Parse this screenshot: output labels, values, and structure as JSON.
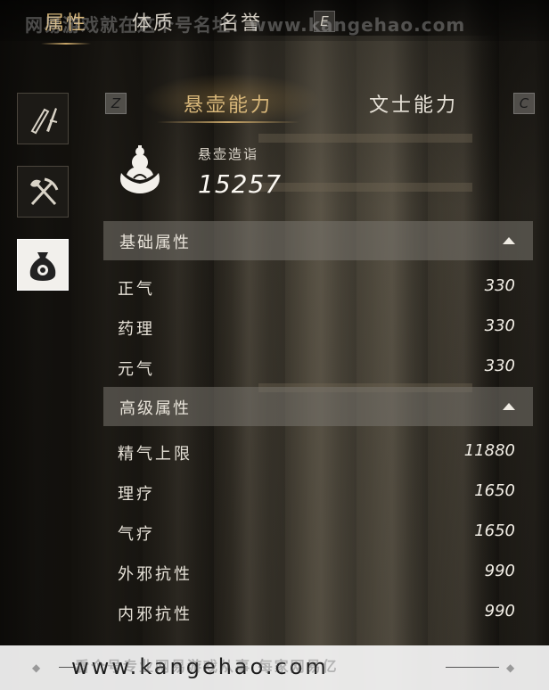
{
  "top_tabs": [
    {
      "label": "属性",
      "active": true
    },
    {
      "label": "体质",
      "active": false
    },
    {
      "label": "名誉",
      "active": false
    }
  ],
  "top_key_hint": "E",
  "watermark_top": "网易游戏就在这个号名址：www.kangehao.com",
  "sidebar": {
    "items": [
      {
        "icon": "sword-scroll-icon",
        "active": false
      },
      {
        "icon": "shovel-pickaxe-icon",
        "active": false
      },
      {
        "icon": "money-bag-icon",
        "active": true
      }
    ]
  },
  "subtabs": {
    "left_key": "Z",
    "right_key": "C",
    "items": [
      {
        "label": "悬壶能力",
        "active": true
      },
      {
        "label": "文士能力",
        "active": false
      }
    ]
  },
  "summary": {
    "icon": "gourd-lotus-icon",
    "label": "悬壶造诣",
    "value": "15257"
  },
  "sections": [
    {
      "title": "基础属性",
      "rows": [
        {
          "label": "正气",
          "value": "330"
        },
        {
          "label": "药理",
          "value": "330"
        },
        {
          "label": "元气",
          "value": "330"
        }
      ]
    },
    {
      "title": "高级属性",
      "rows": [
        {
          "label": "精气上限",
          "value": "11880"
        },
        {
          "label": "理疗",
          "value": "1650"
        },
        {
          "label": "气疗",
          "value": "1650"
        },
        {
          "label": "外邪抗性",
          "value": "990"
        },
        {
          "label": "内邪抗性",
          "value": "990"
        }
      ]
    }
  ],
  "bottom_banner": {
    "text": "www.kangehao.com",
    "overlay": "看个号专业网易游戏从事 每家网易亿"
  },
  "colors": {
    "accent_gold": "#d8b77a",
    "section_bg": "#78746e",
    "text_light": "#e6e1d7"
  }
}
